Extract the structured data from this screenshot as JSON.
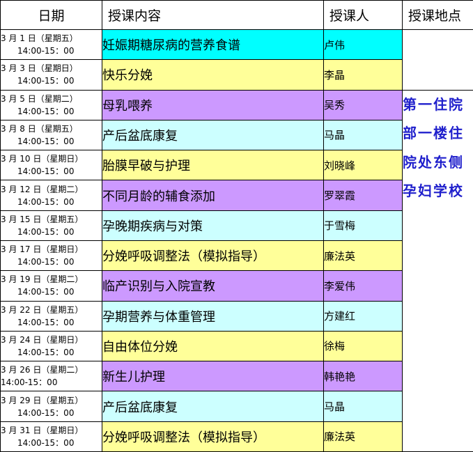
{
  "headers": {
    "date": "日期",
    "topic": "授课内容",
    "teacher": "授课人",
    "place": "授课地点"
  },
  "place": "第一住院部一楼住院处东侧孕妇学校",
  "place_color": "#1f1fcc",
  "colors": {
    "cyan": "#00ffff",
    "yellow": "#ffff99",
    "purple": "#cc99ff",
    "lightcyan": "#ccffff"
  },
  "rows": [
    {
      "date": "3 月 1 日（星期五）",
      "time": "14:00-15：00",
      "topic": "妊娠期糖尿病的营养食谱",
      "teacher": "卢伟",
      "color": "#00ffff"
    },
    {
      "date": "3 月 3 日（星期日）",
      "time": "14:00-15：00",
      "topic": "快乐分娩",
      "teacher": "李晶",
      "color": "#ffff99"
    },
    {
      "date": "3 月 5 日（星期二）",
      "time": "14:00-15：00",
      "topic": "母乳喂养",
      "teacher": "吴秀",
      "color": "#cc99ff"
    },
    {
      "date": "3 月 8 日（星期五）",
      "time": "14:00-15：00",
      "topic": "产后盆底康复",
      "teacher": "马晶",
      "color": "#ccffff"
    },
    {
      "date": "3 月 10 日（星期日）",
      "time": "14:00-15：00",
      "topic": "胎膜早破与护理",
      "teacher": "刘晓峰",
      "color": "#ffff99"
    },
    {
      "date": "3 月 12 日（星期二）",
      "time": "14:00-15：00",
      "topic": "不同月龄的辅食添加",
      "teacher": "罗翠霞",
      "color": "#cc99ff"
    },
    {
      "date": "3 月 15 日（星期五）",
      "time": "14:00-15：00",
      "topic": "孕晚期疾病与对策",
      "teacher": "于雪梅",
      "color": "#ccffff"
    },
    {
      "date": "3 月 17 日（星期日）",
      "time": "14:00-15：00",
      "topic": "分娩呼吸调整法（模拟指导）",
      "teacher": "廉法英",
      "color": "#ffff99"
    },
    {
      "date": "3 月 19 日（星期二）",
      "time": "14:00-15：00",
      "topic": "临产识别与入院宣教",
      "teacher": "李爱伟",
      "color": "#cc99ff"
    },
    {
      "date": "3 月 22 日（星期五）",
      "time": "14:00-15：00",
      "topic": "孕期营养与体重管理",
      "teacher": "方建红",
      "color": "#ccffff"
    },
    {
      "date": "3 月 24 日（星期日）",
      "time": "14:00-15：00",
      "topic": "自由体位分娩",
      "teacher": "徐梅",
      "color": "#ffff99"
    },
    {
      "date": "3 月 26 日（星期二）",
      "time": "14:00-15：00",
      "topic": "新生儿护理",
      "teacher": "韩艳艳",
      "color": "#cc99ff"
    },
    {
      "date": "3 月 29 日（星期五）",
      "time": "14:00-15：00",
      "topic": "产后盆底康复",
      "teacher": "马晶",
      "color": "#ccffff"
    },
    {
      "date": "3 月 31 日（星期日）",
      "time": "14:00-15：00",
      "topic": "分娩呼吸调整法（模拟指导）",
      "teacher": "廉法英",
      "color": "#ffff99"
    }
  ]
}
